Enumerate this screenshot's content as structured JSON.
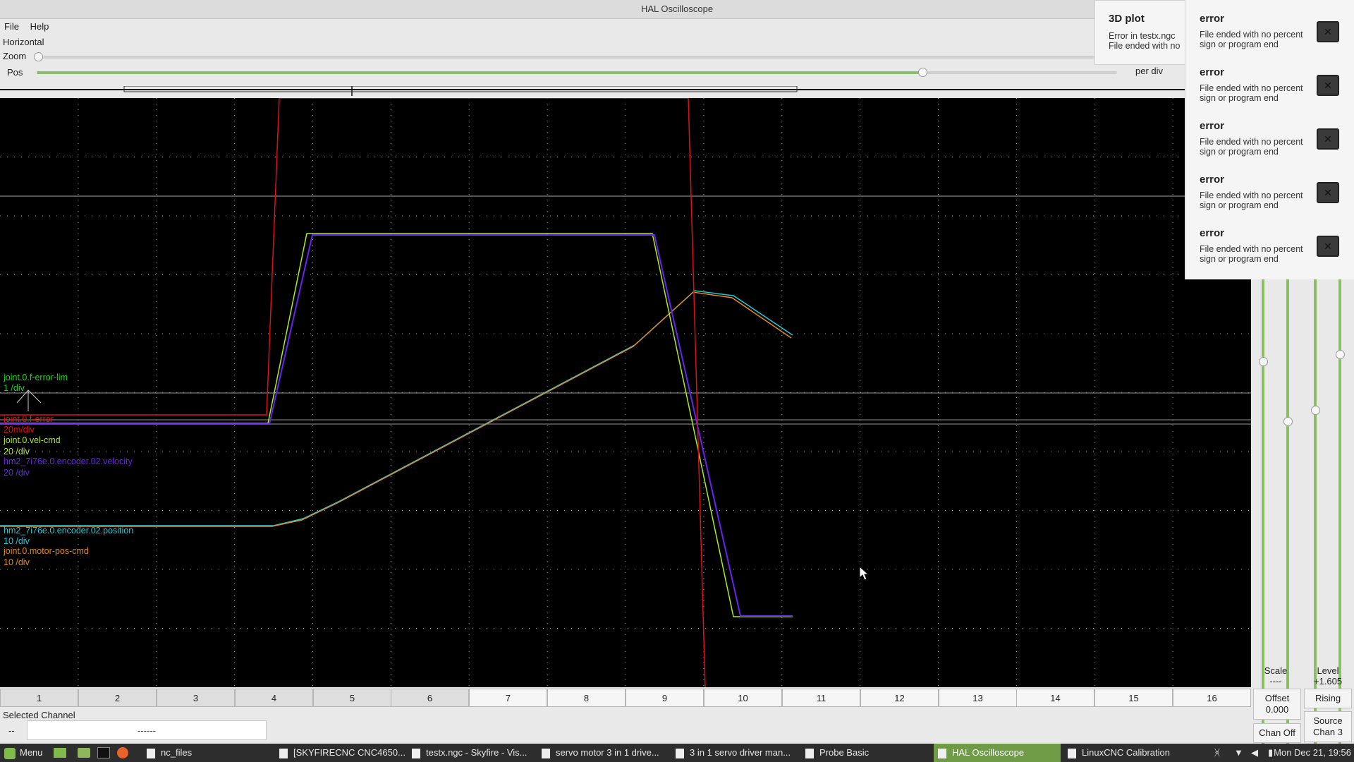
{
  "window": {
    "title": "HAL Oscilloscope"
  },
  "menu": {
    "file": "File",
    "help": "Help"
  },
  "horizontal": {
    "label": "Horizontal",
    "zoom_label": "Zoom",
    "pos_label": "Pos",
    "per_div_label": "per div",
    "zoom_level": 0.0,
    "pos_level": 0.82
  },
  "traces": {
    "error_lim": {
      "name": "joint.0.f-error-lim",
      "scale": "1 /div",
      "color": "#22cc22"
    },
    "f_error": {
      "name": "joint.0.f-error",
      "scale": "20m/div",
      "color": "#dd1111"
    },
    "vel_cmd": {
      "name": "joint.0.vel-cmd",
      "scale": "20 /div",
      "color": "#aaee22"
    },
    "enc_vel": {
      "name": "hm2_7i76e.0.encoder.02.velocity",
      "scale": "20 /div",
      "color": "#6a22ee"
    },
    "enc_pos": {
      "name": "hm2_7i76e.0.encoder.02.position",
      "scale": "10 /div",
      "color": "#1ec8d8"
    },
    "motor_pos": {
      "name": "joint.0.motor-pos-cmd",
      "scale": "10 /div",
      "color": "#e08a1a"
    }
  },
  "channels": [
    "1",
    "2",
    "3",
    "4",
    "5",
    "6",
    "7",
    "8",
    "9",
    "10",
    "11",
    "12",
    "13",
    "14",
    "15",
    "16"
  ],
  "selected_channel": {
    "label": "Selected Channel",
    "prefix": "--",
    "value": "------"
  },
  "vertical": {
    "scale_label": "Scale",
    "scale_value": "----",
    "level_label": "Level",
    "level_value": "+1.605",
    "offset_label": "Offset",
    "offset_value": "0.000",
    "edge": "Rising",
    "chan_off": "Chan Off",
    "source_label": "Source",
    "source_value": "Chan 3"
  },
  "notification_3d": {
    "title": "3D plot",
    "line1": "Error in testx.ngc",
    "line2": "File ended with no"
  },
  "notifications": [
    {
      "title": "error",
      "line1": "File ended with no percent",
      "line2": "sign or program end"
    },
    {
      "title": "error",
      "line1": "File ended with no percent",
      "line2": "sign or program end"
    },
    {
      "title": "error",
      "line1": "File ended with no percent",
      "line2": "sign or program end"
    },
    {
      "title": "error",
      "line1": "File ended with no percent",
      "line2": "sign or program end"
    },
    {
      "title": "error",
      "line1": "File ended with no percent",
      "line2": "sign or program end"
    }
  ],
  "taskbar": {
    "menu": "Menu",
    "items": [
      "nc_files",
      "[SKYFIRECNC CNC4650...",
      "testx.ngc - Skyfire - Vis...",
      "servo motor 3 in 1 drive...",
      "3 in 1 servo driver man...",
      "Probe Basic",
      "HAL Oscilloscope",
      "LinuxCNC Calibration"
    ],
    "clock": "Mon Dec 21, 19:56"
  }
}
